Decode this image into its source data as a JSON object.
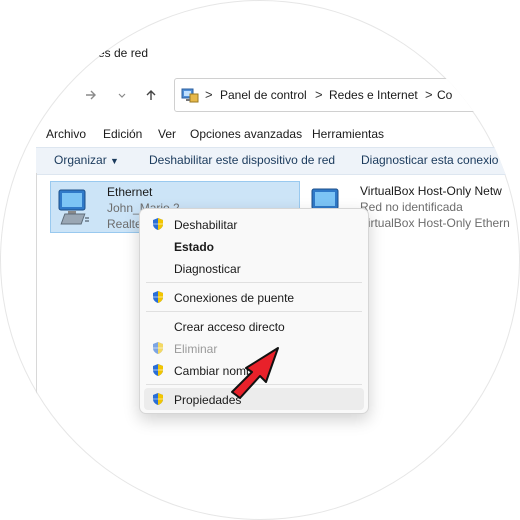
{
  "window": {
    "title": "es de red"
  },
  "nav": {
    "forward_icon": "arrow-right-icon",
    "dropdown_icon": "chevron-down-icon",
    "up_icon": "arrow-up-icon"
  },
  "address": {
    "crumbs": [
      "Panel de control",
      "Redes e Internet",
      "Co"
    ],
    "separator": ">"
  },
  "menubar": {
    "items": [
      "Archivo",
      "Edición",
      "Ver",
      "Opciones avanzadas",
      "Herramientas"
    ]
  },
  "commandbar": {
    "organize": "Organizar",
    "disable": "Deshabilitar este dispositivo de red",
    "diagnose": "Diagnosticar esta conexio"
  },
  "adapters": [
    {
      "name": "Ethernet",
      "line1": "John_Mario 2",
      "line2": "Realte"
    },
    {
      "name": "VirtualBox Host-Only Netw",
      "line1": "Red no identificada",
      "line2": "VirtualBox Host-Only Ethern"
    }
  ],
  "context_menu": {
    "items": [
      {
        "label": "Deshabilitar",
        "shield": true
      },
      {
        "label": "Estado",
        "bold": true
      },
      {
        "label": "Diagnosticar"
      },
      {
        "label": "Conexiones de puente",
        "shield": true
      },
      {
        "label": "Crear acceso directo"
      },
      {
        "label": "Eliminar",
        "shield": true,
        "disabled": true
      },
      {
        "label": "Cambiar nombre",
        "shield": true
      },
      {
        "label": "Propiedades",
        "shield": true,
        "highlighted": true
      }
    ]
  },
  "colors": {
    "selection": "#cce4f7",
    "command_bar": "#eef3f9",
    "arrow": "#e8212a"
  }
}
